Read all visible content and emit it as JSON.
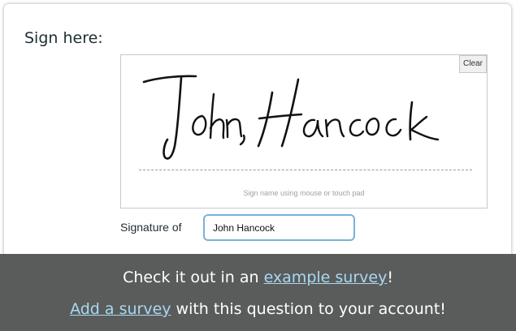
{
  "question": {
    "label": "Sign here:"
  },
  "signature_pad": {
    "clear_label": "Clear",
    "hint": "Sign name using mouse or touch pad",
    "signature_text": "John Hancock"
  },
  "signature_of": {
    "label": "Signature of",
    "value": "John Hancock"
  },
  "footer": {
    "line1_prefix": "Check it out in an ",
    "line1_link": "example survey",
    "line1_suffix": "!",
    "line2_link": "Add a survey",
    "line2_suffix": " with this question to your account!"
  },
  "colors": {
    "footer_bg": "#5a5c5c",
    "link": "#a9d8f0",
    "input_border": "#7cb1d6"
  }
}
